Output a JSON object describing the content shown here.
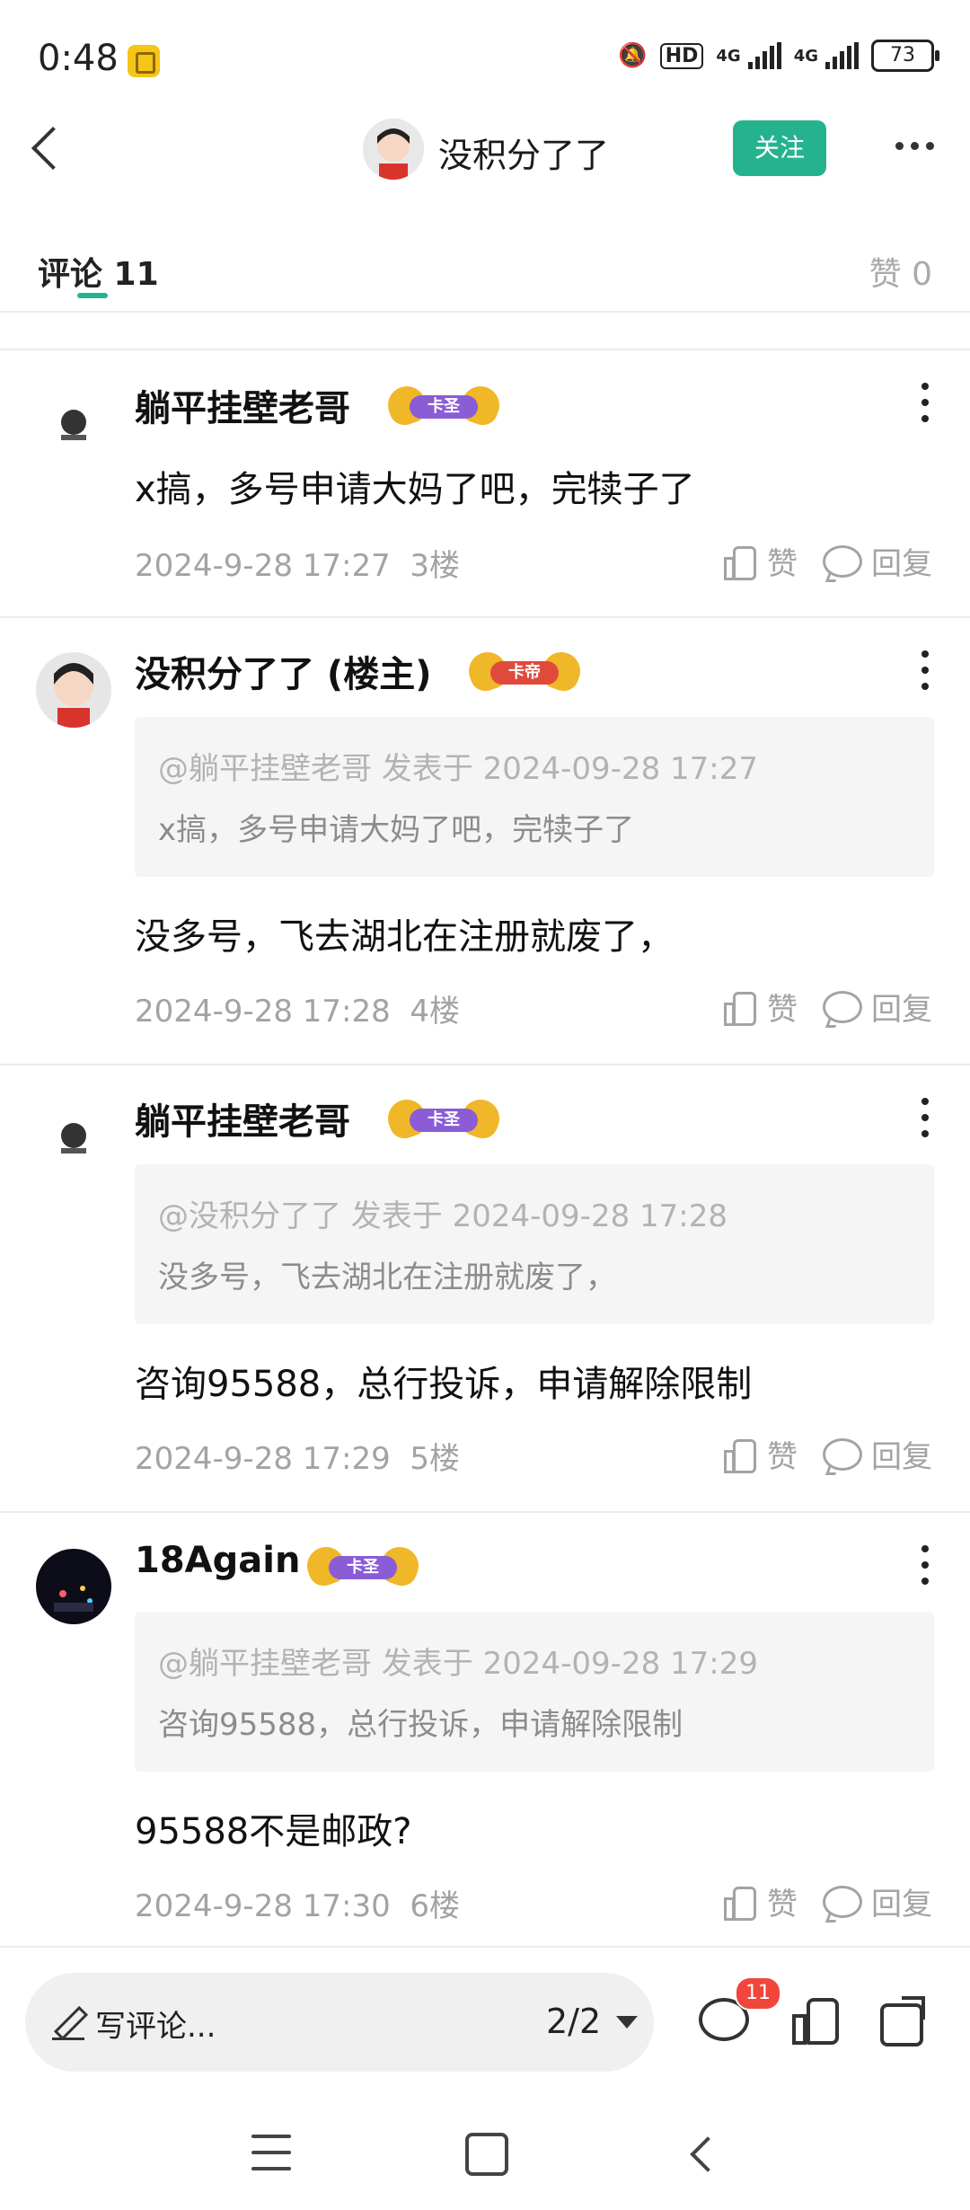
{
  "status_bar": {
    "time": "0:48",
    "hd_label": "HD",
    "net1": "4G",
    "net2": "4G",
    "battery": "73"
  },
  "header": {
    "title": "没积分了了",
    "follow_label": "关注",
    "more_icon": "more-horizontal-icon"
  },
  "tabs": {
    "comments_label": "评论 11",
    "likes_label": "赞 0"
  },
  "comments": [
    {
      "user": "躺平挂壁老哥",
      "badge": "卡圣",
      "badge_color": "#8a5cd6",
      "text": "x搞，多号申请大妈了吧，完犊子了",
      "time": "2024-9-28 17:27",
      "floor": "3楼",
      "like_label": "赞",
      "reply_label": "回复"
    },
    {
      "user": "没积分了了 (楼主)",
      "badge": "卡帝",
      "badge_color": "#e04a3b",
      "quote_header": "@躺平挂壁老哥 发表于 2024-09-28 17:27",
      "quote_text": "x搞，多号申请大妈了吧，完犊子了",
      "text": "没多号，飞去湖北在注册就废了，",
      "time": "2024-9-28 17:28",
      "floor": "4楼",
      "like_label": "赞",
      "reply_label": "回复"
    },
    {
      "user": "躺平挂壁老哥",
      "badge": "卡圣",
      "badge_color": "#8a5cd6",
      "quote_header": "@没积分了了 发表于 2024-09-28 17:28",
      "quote_text": "没多号，飞去湖北在注册就废了，",
      "text": "咨询95588，总行投诉，申请解除限制",
      "time": "2024-9-28 17:29",
      "floor": "5楼",
      "like_label": "赞",
      "reply_label": "回复"
    },
    {
      "user": "18Again",
      "badge": "卡圣",
      "badge_color": "#8a5cd6",
      "quote_header": "@躺平挂壁老哥 发表于 2024-09-28 17:29",
      "quote_text": "咨询95588，总行投诉，申请解除限制",
      "text": "95588不是邮政?",
      "time": "2024-9-28 17:30",
      "floor": "6楼",
      "like_label": "赞",
      "reply_label": "回复"
    }
  ],
  "bottom_bar": {
    "placeholder": "写评论...",
    "page_indicator": "2/2",
    "comment_count": "11"
  },
  "colors": {
    "accent": "#25b38f",
    "badge_red": "#f0463c"
  }
}
